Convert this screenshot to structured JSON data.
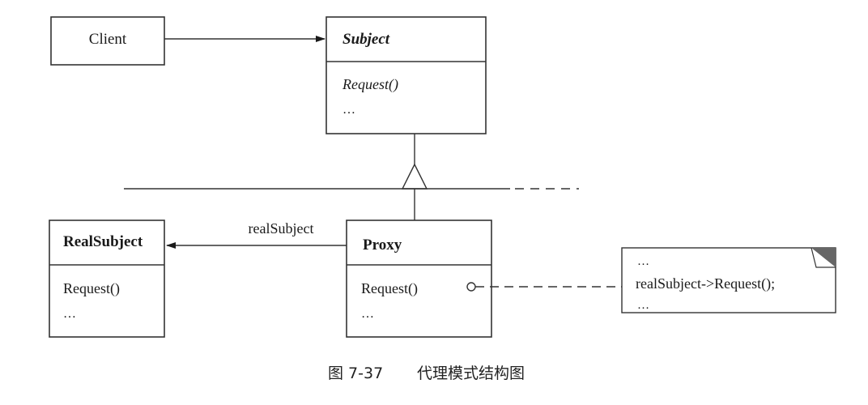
{
  "classes": {
    "client": {
      "name": "Client"
    },
    "subject": {
      "name": "Subject",
      "operation": "Request()",
      "more": "…"
    },
    "real_subject": {
      "name": "RealSubject",
      "operation": "Request()",
      "more": "…"
    },
    "proxy": {
      "name": "Proxy",
      "operation": "Request()",
      "more": "…"
    }
  },
  "associations": {
    "proxy_to_real_subject": {
      "label": "realSubject"
    }
  },
  "note": {
    "lines": [
      "…",
      "realSubject->Request();",
      "…"
    ]
  },
  "caption": {
    "figure_number": "图 7-37",
    "title": "代理模式结构图"
  }
}
